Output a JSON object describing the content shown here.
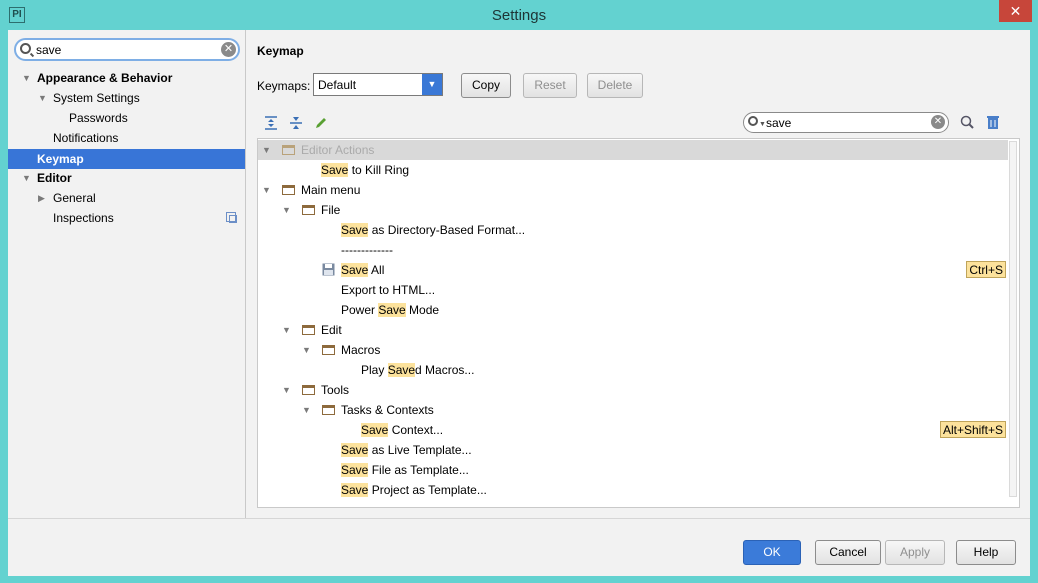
{
  "window": {
    "title": "Settings",
    "app_icon": "PI",
    "close_glyph": "✕"
  },
  "sidebar": {
    "search": {
      "value": "save",
      "clear_glyph": "✕"
    },
    "items": [
      {
        "label": "Appearance & Behavior",
        "level": 0,
        "bold": true,
        "expanded": true
      },
      {
        "label": "System Settings",
        "level": 1,
        "bold": false,
        "expanded": true
      },
      {
        "label": "Passwords",
        "level": 2,
        "bold": false
      },
      {
        "label": "Notifications",
        "level": 1,
        "bold": false
      },
      {
        "label": "Keymap",
        "level": 0,
        "bold": true,
        "selected": true
      },
      {
        "label": "Editor",
        "level": 0,
        "bold": true,
        "expanded": true
      },
      {
        "label": "General",
        "level": 1,
        "bold": false,
        "expanded": false
      },
      {
        "label": "Inspections",
        "level": 1,
        "bold": false
      }
    ]
  },
  "keymap": {
    "heading": "Keymap",
    "keymaps_label": "Keymaps:",
    "selected_keymap": "Default",
    "buttons": {
      "copy": "Copy",
      "reset": "Reset",
      "delete": "Delete"
    },
    "filter": {
      "value": "save",
      "clear_glyph": "✕"
    },
    "tree": {
      "editor_actions": "Editor Actions",
      "save_kill_ring": {
        "hl": "Save",
        "rest": " to Kill Ring"
      },
      "main_menu": "Main menu",
      "file": "File",
      "save_dir_based": {
        "hl": "Save",
        "rest": " as Directory-Based Format..."
      },
      "separator": "-------------",
      "save_all": {
        "hl": "Save",
        "rest": " All",
        "shortcut": "Ctrl+S"
      },
      "export_html": "Export to HTML...",
      "power_save": {
        "pre": "Power ",
        "hl": "Save",
        "rest": " Mode"
      },
      "edit": "Edit",
      "macros": "Macros",
      "play_saved": {
        "pre": "Play ",
        "hl": "Save",
        "rest": "d Macros..."
      },
      "tools": "Tools",
      "tasks_contexts": "Tasks & Contexts",
      "save_context": {
        "hl": "Save",
        "rest": " Context...",
        "shortcut": "Alt+Shift+S"
      },
      "save_live_template": {
        "hl": "Save",
        "rest": " as Live Template..."
      },
      "save_file_template": {
        "hl": "Save",
        "rest": " File as Template..."
      },
      "save_project_template": {
        "hl": "Save",
        "rest": " Project as Template..."
      }
    }
  },
  "footer": {
    "ok": "OK",
    "cancel": "Cancel",
    "apply": "Apply",
    "help": "Help"
  },
  "colors": {
    "selection": "#3875d7",
    "highlight": "#fce29c",
    "primary_button": "#3b7bd9",
    "window_frame": "#63d2d0"
  },
  "icons": [
    "search-icon",
    "clear-icon",
    "expand-all-icon",
    "collapse-all-icon",
    "edit-pencil-icon",
    "find-shortcut-icon",
    "trash-icon",
    "folder-icon",
    "floppy-save-icon",
    "copy-page-icon"
  ]
}
